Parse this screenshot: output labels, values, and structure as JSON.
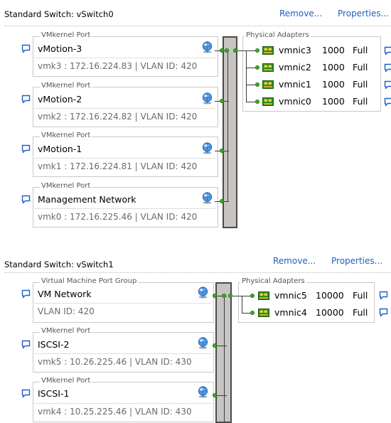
{
  "switches": [
    {
      "title": "Standard Switch: vSwitch0",
      "actions": {
        "remove": "Remove...",
        "properties": "Properties..."
      },
      "ports": [
        {
          "group_label": "VMkernel Port",
          "name": "vMotion-3",
          "detail": "vmk3 : 172.16.224.83 | VLAN ID: 420"
        },
        {
          "group_label": "VMkernel Port",
          "name": "vMotion-2",
          "detail": "vmk2 : 172.16.224.82 | VLAN ID: 420"
        },
        {
          "group_label": "VMkernel Port",
          "name": "vMotion-1",
          "detail": "vmk1 : 172.16.224.81 | VLAN ID: 420"
        },
        {
          "group_label": "VMkernel Port",
          "name": "Management Network",
          "detail": "vmk0 : 172.16.225.46 | VLAN ID: 420"
        }
      ],
      "adapters_label": "Physical Adapters",
      "adapters": [
        {
          "name": "vmnic3",
          "speed": "1000",
          "duplex": "Full"
        },
        {
          "name": "vmnic2",
          "speed": "1000",
          "duplex": "Full"
        },
        {
          "name": "vmnic1",
          "speed": "1000",
          "duplex": "Full"
        },
        {
          "name": "vmnic0",
          "speed": "1000",
          "duplex": "Full"
        }
      ]
    },
    {
      "title": "Standard Switch: vSwitch1",
      "actions": {
        "remove": "Remove...",
        "properties": "Properties..."
      },
      "ports": [
        {
          "group_label": "Virtual Machine Port Group",
          "name": "VM Network",
          "detail": "VLAN ID: 420"
        },
        {
          "group_label": "VMkernel Port",
          "name": "ISCSI-2",
          "detail": "vmk5 : 10.26.225.46 | VLAN ID: 430"
        },
        {
          "group_label": "VMkernel Port",
          "name": "ISCSI-1",
          "detail": "vmk4 : 10.25.225.46 | VLAN ID: 430"
        }
      ],
      "adapters_label": "Physical Adapters",
      "adapters": [
        {
          "name": "vmnic5",
          "speed": "10000",
          "duplex": "Full"
        },
        {
          "name": "vmnic4",
          "speed": "10000",
          "duplex": "Full"
        }
      ]
    }
  ],
  "colors": {
    "link": "#1f5fbf",
    "link_dot": "#3ab01e",
    "switch_bar": "#c7c4c1",
    "info_bubble": "#1c5fc9"
  },
  "icons": {
    "info": "speech-bubble-icon",
    "network": "network-globe-icon",
    "nic": "network-card-icon"
  }
}
